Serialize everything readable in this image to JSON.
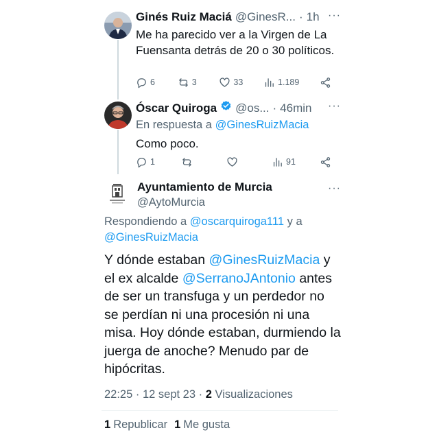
{
  "tweets": [
    {
      "name": "Ginés Ruiz Maciá",
      "handle": "@GinesR...",
      "dot": "·",
      "time": "1h",
      "more": "···",
      "text": "Me ha parecido ver a la Virgen de La Fuensanta detrás de 20 o 30 políticos.",
      "replies": "6",
      "retweets": "3",
      "likes": "33",
      "views": "1.189"
    },
    {
      "name": "Óscar Quiroga",
      "verified": true,
      "handle": "@os...",
      "dot": "·",
      "time": "46min",
      "more": "···",
      "reply_prefix": "En respuesta a",
      "reply_mention": "@GinesRuizMacia",
      "text": "Como poco.",
      "replies": "1",
      "retweets": "",
      "likes": "",
      "views": "91"
    }
  ],
  "main_tweet": {
    "name": "Ayuntamiento de Murcia",
    "handle": "@AytoMurcia",
    "more": "···",
    "reply_prefix": "Respondiendo a",
    "reply_mention_1": "@oscarquiroga111",
    "reply_and": "y a",
    "reply_mention_2": "@GinesRuizMacia",
    "text_1": "Y dónde estaban",
    "mention_1": "@GinesRuizMacia",
    "text_2": "y el ex alcalde",
    "mention_2": "@SerranoJAntonio",
    "text_3": "antes de ser un transfuga y un perdedor no se perdían ni una procesión ni una misa. Hoy dónde estaban, durmiendo la juerga de anoche? Menudo par de hipócritas.",
    "timestamp": "22:25 · 12 sept 23",
    "sep": "·",
    "views_count": "2",
    "views_label": "Visualizaciones",
    "reposts_count": "1",
    "reposts_label": "Republicar",
    "likes_count": "1",
    "likes_label": "Me gusta"
  },
  "colors": {
    "accent": "#1d9bf0",
    "muted": "#536471",
    "text": "#0f1419"
  }
}
